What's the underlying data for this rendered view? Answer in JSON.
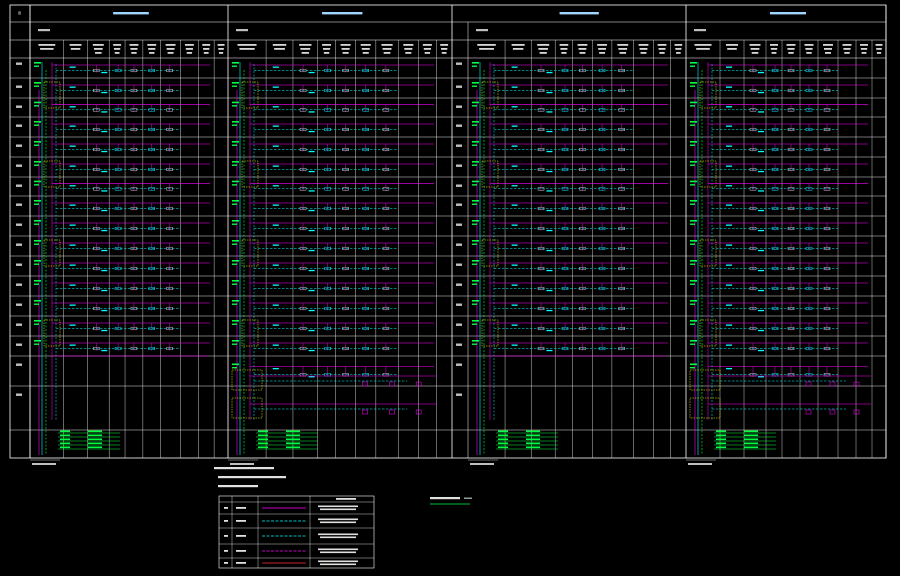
{
  "drawing": {
    "left_corner_label": "层",
    "panels": [
      {
        "title": "",
        "subtitle": ""
      },
      {
        "title": "",
        "subtitle": ""
      },
      {
        "title": "",
        "subtitle": ""
      },
      {
        "title": "",
        "subtitle": ""
      }
    ],
    "column_headers": [
      "",
      "",
      "",
      "",
      "",
      "",
      "",
      "",
      "",
      "",
      "",
      ""
    ],
    "floor_labels": [
      "",
      "",
      "",
      "",
      "",
      "",
      "",
      "",
      "",
      "",
      "",
      "",
      "",
      "",
      "",
      "",
      ""
    ],
    "bottom_notes": [
      "",
      "",
      ""
    ],
    "legend": {
      "headers": [
        "",
        "",
        ""
      ],
      "rows": 5
    },
    "legend_title": "",
    "colors": {
      "grid": "#ffffff",
      "magenta": "#ff00ff",
      "cyan": "#00ffff",
      "green": "#00ff40",
      "yellow": "#ffff00",
      "red": "#ff3030",
      "background": "#000000"
    },
    "line_types": [
      "magenta-solid",
      "cyan-dashed",
      "green-dashed",
      "yellow-dashed"
    ]
  }
}
